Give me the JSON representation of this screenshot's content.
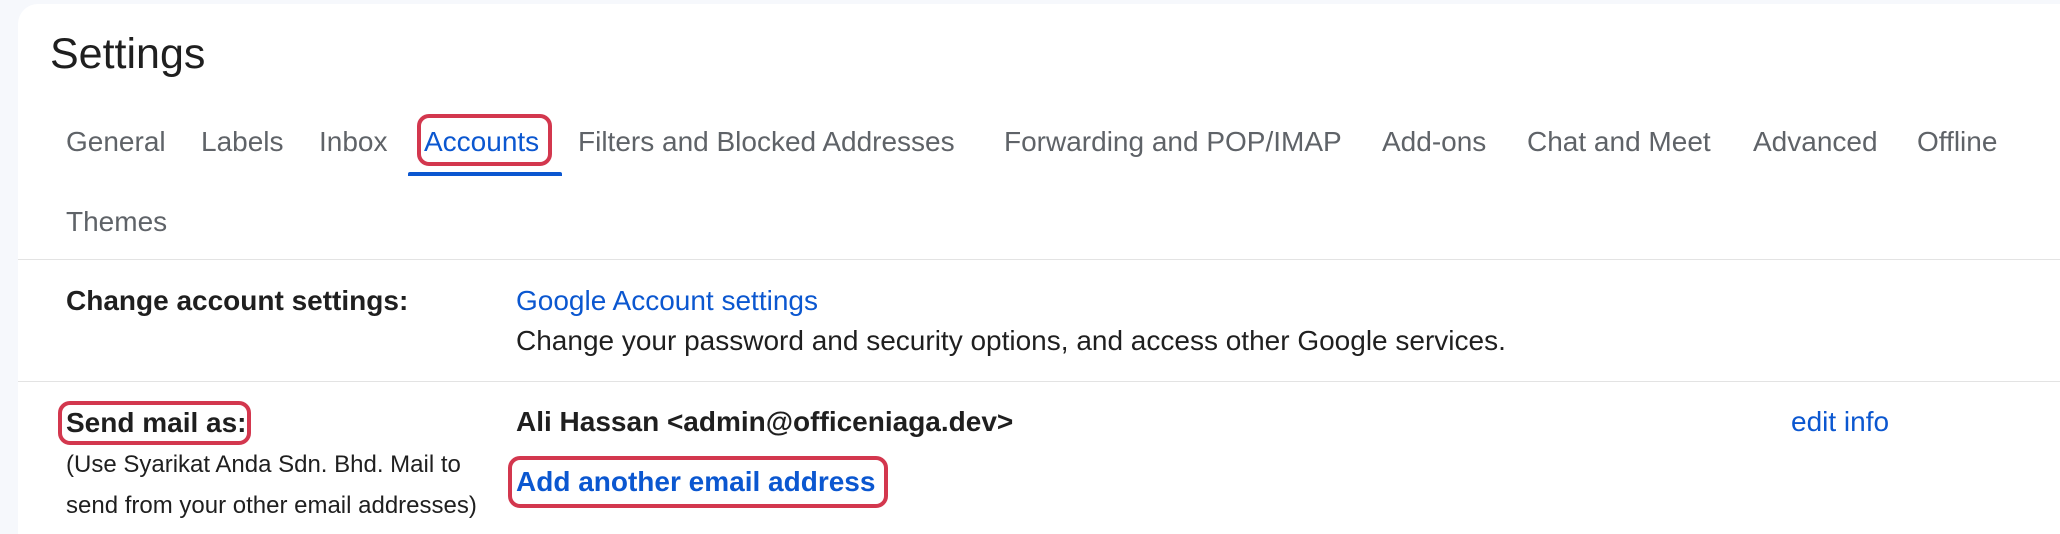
{
  "page": {
    "title": "Settings"
  },
  "tabs": [
    {
      "label": "General"
    },
    {
      "label": "Labels"
    },
    {
      "label": "Inbox"
    },
    {
      "label": "Accounts",
      "active": true
    },
    {
      "label": "Filters and Blocked Addresses"
    },
    {
      "label": "Forwarding and POP/IMAP"
    },
    {
      "label": "Add-ons"
    },
    {
      "label": "Chat and Meet"
    },
    {
      "label": "Advanced"
    },
    {
      "label": "Offline"
    },
    {
      "label": "Themes"
    }
  ],
  "account_settings": {
    "label": "Change account settings:",
    "link": "Google Account settings",
    "description": "Change your password and security options, and access other Google services."
  },
  "send_mail_as": {
    "label": "Send mail as:",
    "description_line1": "(Use Syarikat Anda Sdn. Bhd. Mail to",
    "description_line2": "send from your other email addresses)",
    "identity": "Ali Hassan <admin@officeniaga.dev>",
    "edit_link": "edit info",
    "add_link": "Add another email address"
  },
  "colors": {
    "accent": "#0b57d0",
    "highlight": "#d3374e",
    "text": "#1f1f1f",
    "tab_text": "#5f6368"
  }
}
